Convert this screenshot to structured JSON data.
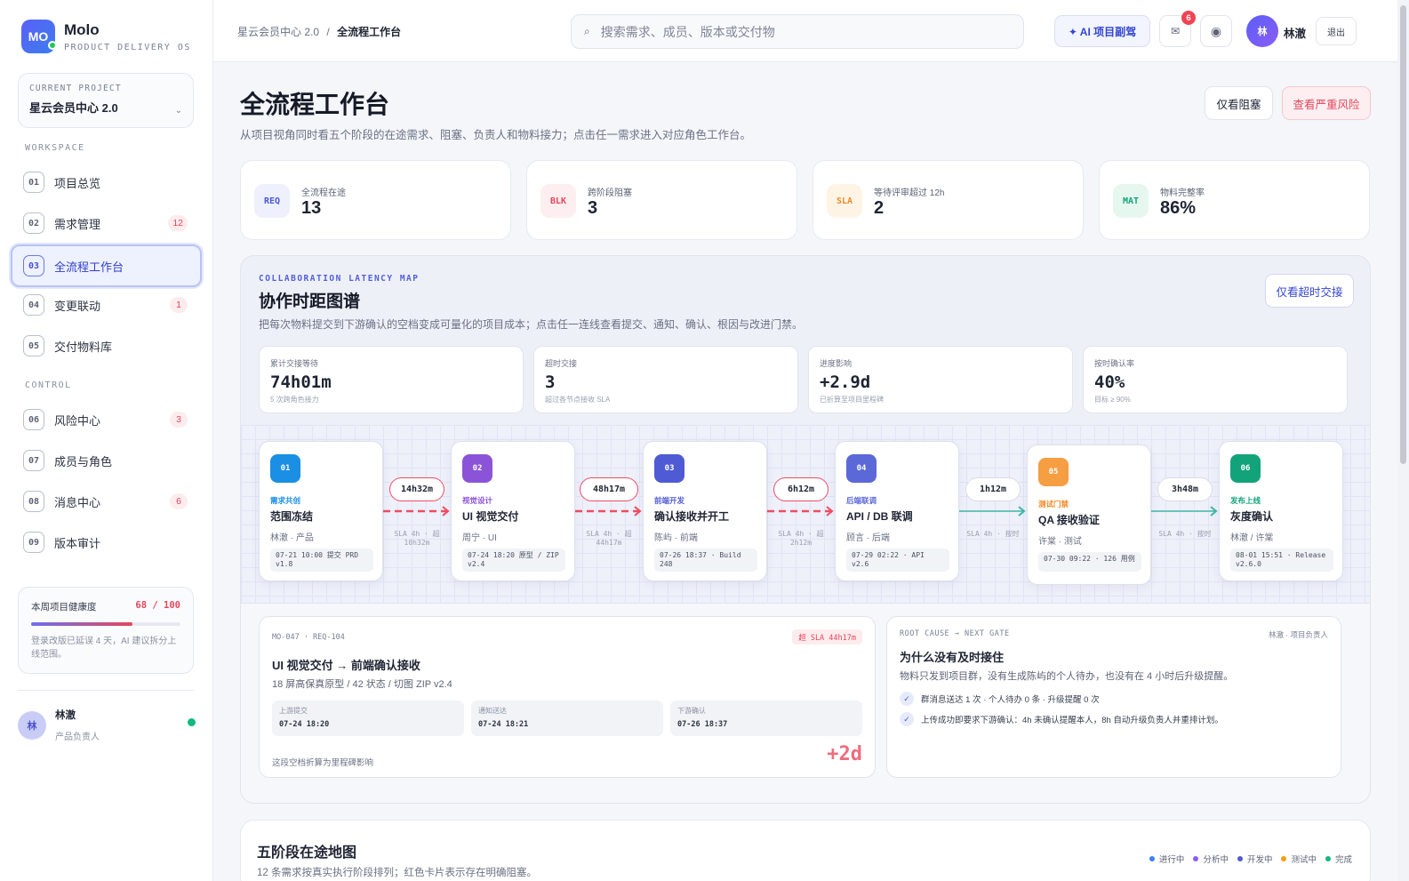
{
  "brand": {
    "logo": "MO",
    "name": "Molo",
    "subtitle": "PRODUCT DELIVERY OS"
  },
  "project": {
    "label": "CURRENT PROJECT",
    "name": "星云会员中心 2.0"
  },
  "sidebar": {
    "workspace_label": "WORKSPACE",
    "control_label": "CONTROL",
    "items": [
      {
        "num": "01",
        "label": "项目总览",
        "badge": ""
      },
      {
        "num": "02",
        "label": "需求管理",
        "badge": "12"
      },
      {
        "num": "03",
        "label": "全流程工作台",
        "badge": ""
      },
      {
        "num": "04",
        "label": "变更联动",
        "badge": "1"
      },
      {
        "num": "05",
        "label": "交付物料库",
        "badge": ""
      },
      {
        "num": "06",
        "label": "风险中心",
        "badge": "3"
      },
      {
        "num": "07",
        "label": "成员与角色",
        "badge": ""
      },
      {
        "num": "08",
        "label": "消息中心",
        "badge": "6"
      },
      {
        "num": "09",
        "label": "版本审计",
        "badge": ""
      }
    ],
    "health": {
      "label": "本周项目健康度",
      "score": "68 / 100",
      "value": 0.68,
      "note": "登录改版已延误 4 天，AI 建议拆分上线范围。"
    },
    "user": {
      "avatar": "林",
      "name": "林澈",
      "role": "产品负责人"
    }
  },
  "topbar": {
    "breadcrumb_parent": "星云会员中心 2.0",
    "breadcrumb_sep": "/",
    "breadcrumb_current": "全流程工作台",
    "search_placeholder": "搜索需求、成员、版本或交付物",
    "search_icon": "⌕",
    "ai_button": "✦ AI 项目副驾",
    "msg_icon": "✉",
    "msg_count": "6",
    "theme_icon": "◉",
    "avatar": "林",
    "user_name": "林澈",
    "logout": "退出"
  },
  "page": {
    "title": "全流程工作台",
    "subtitle": "从项目视角同时看五个阶段的在途需求、阻塞、负责人和物料接力；点击任一需求进入对应角色工作台。",
    "btn_blocked": "仅看阻塞",
    "btn_risk": "查看严重风险"
  },
  "stats": [
    {
      "chip": "REQ",
      "label": "全流程在途",
      "value": "13"
    },
    {
      "chip": "BLK",
      "label": "跨阶段阻塞",
      "value": "3"
    },
    {
      "chip": "SLA",
      "label": "等待评审超过 12h",
      "value": "2"
    },
    {
      "chip": "MAT",
      "label": "物料完整率",
      "value": "86%"
    }
  ],
  "latency": {
    "kicker": "COLLABORATION LATENCY MAP",
    "title": "协作时距图谱",
    "subtitle": "把每次物料提交到下游确认的空档变成可量化的项目成本；点击任一连线查看提交、通知、确认、根因与改进门禁。",
    "btn_overdue": "仅看超时交接",
    "metrics": [
      {
        "label": "累计交接等待",
        "value": "74h01m",
        "note": "5 次跨角色接力"
      },
      {
        "label": "超时交接",
        "value": "3",
        "note": "超过各节点接收 SLA"
      },
      {
        "label": "进度影响",
        "value": "+2.9d",
        "note": "已折算至项目里程碑"
      },
      {
        "label": "按时确认率",
        "value": "40%",
        "note": "目标 ≥ 90%"
      }
    ],
    "nodes": [
      {
        "num": "01",
        "stage": "需求共创",
        "title": "范围冻结",
        "people": "林澈 · 产品",
        "log": "07-21 10:00 提交 PRD v1.8"
      },
      {
        "num": "02",
        "stage": "视觉设计",
        "title": "UI 视觉交付",
        "people": "周宁 · UI",
        "log": "07-24 18:20 原型 / ZIP v2.4"
      },
      {
        "num": "03",
        "stage": "前端开发",
        "title": "确认接收并开工",
        "people": "陈屿 · 前端",
        "log": "07-26 18:37 · Build 248"
      },
      {
        "num": "04",
        "stage": "后端联调",
        "title": "API / DB 联调",
        "people": "顾言 · 后端",
        "log": "07-29 02:22 · API v2.6"
      },
      {
        "num": "05",
        "stage": "测试门禁",
        "title": "QA 接收验证",
        "people": "许棠 · 测试",
        "log": "07-30 09:22 · 126 用例"
      },
      {
        "num": "06",
        "stage": "发布上线",
        "title": "灰度确认",
        "people": "林澈 / 许棠",
        "log": "08-01 15:51 · Release v2.6.0"
      }
    ],
    "links": [
      {
        "time": "14h32m",
        "note": "SLA 4h · 超 10h32m",
        "overdue": true
      },
      {
        "time": "48h17m",
        "note": "SLA 4h · 超 44h17m",
        "overdue": true
      },
      {
        "time": "6h12m",
        "note": "SLA 4h · 超 2h12m",
        "overdue": true
      },
      {
        "time": "1h12m",
        "note": "SLA 4h · 按时",
        "overdue": false
      },
      {
        "time": "3h48m",
        "note": "SLA 4h · 按时",
        "overdue": false
      }
    ],
    "detail": {
      "meta": "MO-047 · REQ-104",
      "tag": "超 SLA 44h17m",
      "title": "UI 视觉交付 → 前端确认接收",
      "sub": "18 屏高保真原型 / 42 状态 / 切图 ZIP v2.4",
      "boxes": [
        {
          "label": "上游提交",
          "value": "07-24 18:20"
        },
        {
          "label": "通知送达",
          "value": "07-24 18:21"
        },
        {
          "label": "下游确认",
          "value": "07-26 18:37"
        }
      ],
      "foot": "这段空档折算为里程碑影响",
      "impact": "+2d"
    },
    "rootcause": {
      "head": "ROOT CAUSE → NEXT GATE",
      "owner": "林澈 · 项目负责人",
      "title": "为什么没有及时接住",
      "sub": "物料只发到项目群，没有生成陈屿的个人待办，也没有在 4 小时后升级提醒。",
      "rows": [
        "群消息送达 1 次 · 个人待办 0 条 · 升级提醒 0 次",
        "上传成功即要求下游确认：4h 未确认提醒本人，8h 自动升级负责人并重排计划。"
      ]
    }
  },
  "stages_map": {
    "title": "五阶段在途地图",
    "subtitle": "12 条需求按真实执行阶段排列；红色卡片表示存在明确阻塞。",
    "legend": [
      {
        "label": "进行中",
        "color": "#3b82f6"
      },
      {
        "label": "分析中",
        "color": "#8b5cf6"
      },
      {
        "label": "开发中",
        "color": "#4f5bd5"
      },
      {
        "label": "测试中",
        "color": "#f59e0b"
      },
      {
        "label": "完成",
        "color": "#10b981"
      }
    ]
  },
  "colors": {
    "accent": "#4452d6",
    "danger": "#e4475c",
    "stage": [
      "#1a8fe3",
      "#8b54d8",
      "#4f5bd5",
      "#5a68d8",
      "#f59e42",
      "#13a37a"
    ],
    "stage_text": [
      "#1a8fe3",
      "#8b54d8",
      "#4f5bd5",
      "#5a68d8",
      "#f08a2a",
      "#13a37a"
    ]
  }
}
